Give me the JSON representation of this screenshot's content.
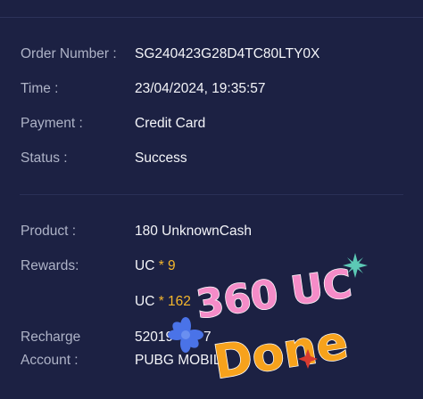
{
  "order": {
    "number_label": "Order Number :",
    "number_value": "SG240423G28D4TC80LTY0X",
    "time_label": "Time :",
    "time_value": "23/04/2024, 19:35:57",
    "payment_label": "Payment :",
    "payment_value": "Credit Card",
    "status_label": "Status :",
    "status_value": "Success"
  },
  "product": {
    "product_label": "Product :",
    "product_value": "180 UnknownCash",
    "rewards_label": "Rewards:",
    "rewards": [
      {
        "name": "UC",
        "multiplier": "* 9"
      },
      {
        "name": "UC",
        "multiplier": "* 162"
      }
    ],
    "recharge_label_line1": "Recharge",
    "recharge_label_line2": "Account :",
    "recharge_value_line1": "52019",
    "recharge_value_line1_tail": "7",
    "recharge_value_line2": "PUBG MOBIL"
  },
  "stickers": {
    "top_text": "360 UC",
    "bottom_text": "Done",
    "top_color": "#f58cc8",
    "bottom_color": "#f7a21c",
    "sparkle_teal": "#5cc9b5",
    "sparkle_blue": "#4a73e8",
    "sparkle_red": "#d93b2f"
  },
  "colors": {
    "background": "#1c2143",
    "label": "#aeb3c7",
    "value": "#f4f5f9",
    "multiplier": "#f5b72c"
  }
}
